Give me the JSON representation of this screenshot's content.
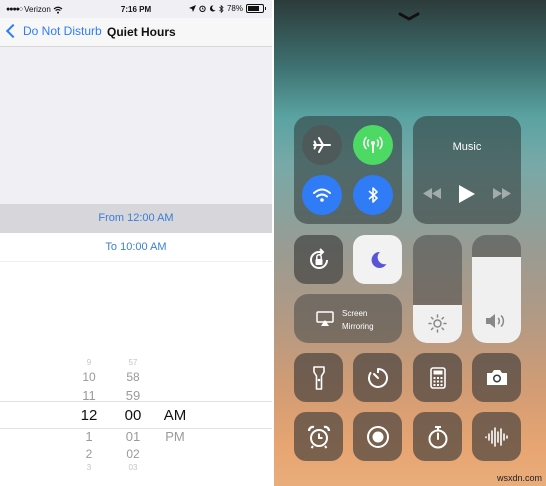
{
  "status_bar": {
    "carrier": "Verizon",
    "time": "7:16 PM",
    "battery": "78%",
    "battery_level": 0.78
  },
  "nav": {
    "back_label": "Do Not Disturb",
    "title": "Quiet Hours"
  },
  "schedule": {
    "from": "From 12:00 AM",
    "to": "To 10:00 AM"
  },
  "picker": {
    "hours": [
      "9",
      "10",
      "11",
      "12",
      "1",
      "2",
      "3"
    ],
    "minutes": [
      "57",
      "58",
      "59",
      "00",
      "01",
      "02",
      "03"
    ],
    "periods": [
      "AM",
      "PM"
    ],
    "selected_hour": "12",
    "selected_minute": "00",
    "selected_period": "AM"
  },
  "control_center": {
    "music_label": "Music",
    "screen_mirroring_line1": "Screen",
    "screen_mirroring_line2": "Mirroring",
    "brightness_level": 0.35,
    "volume_level": 0.8,
    "connectivity": {
      "airplane_mode": false,
      "cellular": true,
      "wifi": true,
      "bluetooth": true
    },
    "colors": {
      "cellular_on": "#4cd964",
      "wifi_on": "#2f7cf6",
      "bluetooth_on": "#2f7cf6",
      "off_button": "#4e5a5a",
      "dnd_moon": "#5856d6"
    }
  },
  "watermark": "wsxdn.com"
}
